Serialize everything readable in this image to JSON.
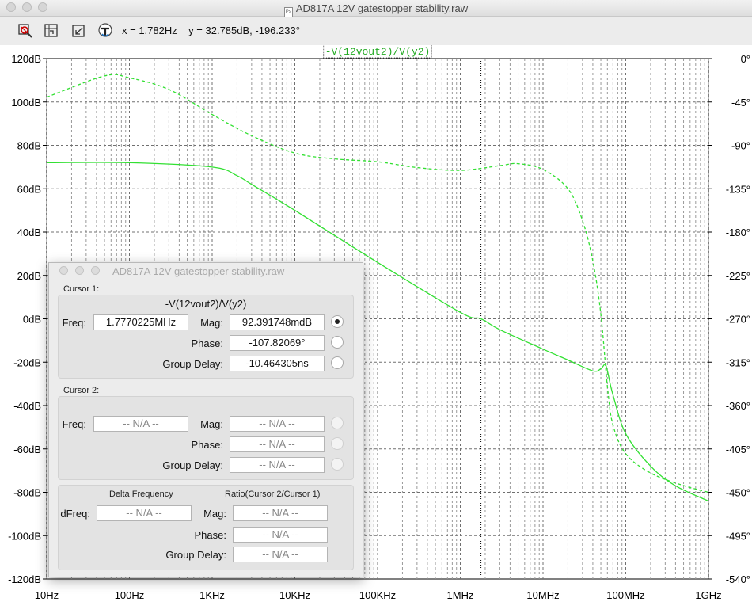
{
  "window": {
    "title": "AD817A 12V gatestopper stability.raw",
    "doc_icon_text": "Ps"
  },
  "toolbar": {
    "tools": [
      {
        "name": "autorange-icon"
      },
      {
        "name": "zoom-box-icon"
      },
      {
        "name": "zoom-back-icon"
      },
      {
        "name": "probe-icon"
      }
    ],
    "readout": "x = 1.782Hz    y = 32.785dB, -196.233°"
  },
  "chart_data": {
    "type": "line",
    "title": "-V(12vout2)/V(y2)",
    "x_scale": "log",
    "xlim": [
      10,
      1000000000
    ],
    "x_ticks": [
      {
        "value": 10,
        "label": "10Hz"
      },
      {
        "value": 100,
        "label": "100Hz"
      },
      {
        "value": 1000,
        "label": "1KHz"
      },
      {
        "value": 10000,
        "label": "10KHz"
      },
      {
        "value": 100000,
        "label": "100KHz"
      },
      {
        "value": 1000000,
        "label": "1MHz"
      },
      {
        "value": 10000000,
        "label": "10MHz"
      },
      {
        "value": 100000000,
        "label": "100MHz"
      },
      {
        "value": 1000000000,
        "label": "1GHz"
      }
    ],
    "ylim_left": [
      -120,
      120
    ],
    "y_ticks_left": [
      {
        "value": 120,
        "label": "120dB"
      },
      {
        "value": 100,
        "label": "100dB"
      },
      {
        "value": 80,
        "label": "80dB"
      },
      {
        "value": 60,
        "label": "60dB"
      },
      {
        "value": 40,
        "label": "40dB"
      },
      {
        "value": 20,
        "label": "20dB"
      },
      {
        "value": 0,
        "label": "0dB"
      },
      {
        "value": -20,
        "label": "-20dB"
      },
      {
        "value": -40,
        "label": "-40dB"
      },
      {
        "value": -60,
        "label": "-60dB"
      },
      {
        "value": -80,
        "label": "-80dB"
      },
      {
        "value": -100,
        "label": "-100dB"
      },
      {
        "value": -120,
        "label": "-120dB"
      }
    ],
    "ylim_right": [
      -540,
      0
    ],
    "y_ticks_right": [
      {
        "value": 0,
        "label": "0°"
      },
      {
        "value": -45,
        "label": "-45°"
      },
      {
        "value": -90,
        "label": "-90°"
      },
      {
        "value": -135,
        "label": "-135°"
      },
      {
        "value": -180,
        "label": "-180°"
      },
      {
        "value": -225,
        "label": "-225°"
      },
      {
        "value": -270,
        "label": "-270°"
      },
      {
        "value": -315,
        "label": "-315°"
      },
      {
        "value": -360,
        "label": "-360°"
      },
      {
        "value": -405,
        "label": "-405°"
      },
      {
        "value": -450,
        "label": "-450°"
      },
      {
        "value": -495,
        "label": "-495°"
      },
      {
        "value": -540,
        "label": "-540°"
      }
    ],
    "grid": true,
    "cursor_x": 1777022.5,
    "color": "#32e032",
    "series": [
      {
        "kind": "magnitude",
        "axis": "left",
        "style": "solid",
        "points": [
          [
            10,
            72
          ],
          [
            100,
            72
          ],
          [
            1000,
            70
          ],
          [
            2000,
            66
          ],
          [
            3000,
            62
          ],
          [
            10000,
            50
          ],
          [
            100000,
            26
          ],
          [
            1000000,
            3
          ],
          [
            1777000,
            0
          ],
          [
            3000000,
            -5
          ],
          [
            10000000,
            -14
          ],
          [
            20000000,
            -19
          ],
          [
            40000000,
            -24
          ],
          [
            50000000,
            -23
          ],
          [
            56000000,
            -21
          ],
          [
            60000000,
            -24
          ],
          [
            70000000,
            -35
          ],
          [
            100000000,
            -53
          ],
          [
            200000000,
            -68
          ],
          [
            400000000,
            -77
          ],
          [
            1000000000,
            -84
          ]
        ]
      },
      {
        "kind": "phase",
        "axis": "right",
        "style": "dashed",
        "points": [
          [
            10,
            -40
          ],
          [
            50,
            -18
          ],
          [
            100,
            -20
          ],
          [
            300,
            -32
          ],
          [
            1000,
            -58
          ],
          [
            3000,
            -80
          ],
          [
            10000,
            -98
          ],
          [
            30000,
            -104
          ],
          [
            100000,
            -107
          ],
          [
            300000,
            -113
          ],
          [
            1000000,
            -116
          ],
          [
            3000000,
            -111
          ],
          [
            5000000,
            -109
          ],
          [
            10000000,
            -115
          ],
          [
            20000000,
            -135
          ],
          [
            30000000,
            -168
          ],
          [
            40000000,
            -210
          ],
          [
            50000000,
            -265
          ],
          [
            60000000,
            -340
          ],
          [
            70000000,
            -380
          ],
          [
            100000000,
            -410
          ],
          [
            200000000,
            -430
          ],
          [
            500000000,
            -443
          ],
          [
            1000000000,
            -450
          ]
        ]
      }
    ]
  },
  "dialog": {
    "title": "AD817A 12V gatestopper stability.raw",
    "cursor1": {
      "label": "Cursor 1:",
      "trace": "-V(12vout2)/V(y2)",
      "freq_label": "Freq:",
      "freq": "1.7770225MHz",
      "mag_label": "Mag:",
      "mag": "92.391748mdB",
      "phase_label": "Phase:",
      "phase": "-107.82069°",
      "gd_label": "Group Delay:",
      "gd": "-10.464305ns"
    },
    "cursor2": {
      "label": "Cursor 2:",
      "freq_label": "Freq:",
      "freq": "-- N/A --",
      "mag_label": "Mag:",
      "mag": "-- N/A --",
      "phase_label": "Phase:",
      "phase": "-- N/A --",
      "gd_label": "Group Delay:",
      "gd": "-- N/A --"
    },
    "delta": {
      "delta_header": "Delta Frequency",
      "ratio_header": "Ratio(Cursor 2/Cursor 1)",
      "dfreq_label": "dFreq:",
      "dfreq": "-- N/A --",
      "mag_label": "Mag:",
      "mag": "-- N/A --",
      "phase_label": "Phase:",
      "phase": "-- N/A --",
      "gd_label": "Group Delay:",
      "gd": "-- N/A --"
    }
  }
}
